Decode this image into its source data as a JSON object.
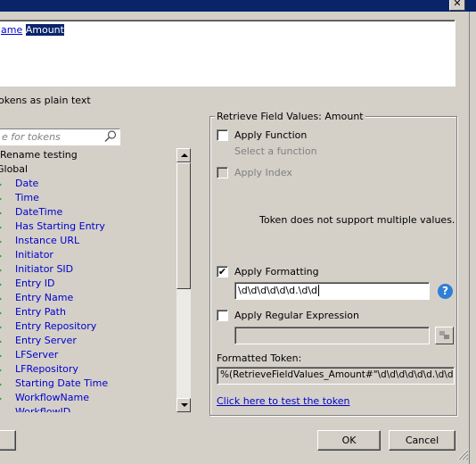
{
  "expression": {
    "prefix": "ame",
    "token": "Amount"
  },
  "plain_text_label": "okens as plain text",
  "search": {
    "placeholder": "e for tokens"
  },
  "tree": {
    "root": "Rename testing",
    "group": "Global",
    "items": [
      "Date",
      "Time",
      "DateTime",
      "Has Starting Entry",
      "Instance URL",
      "Initiator",
      "Initiator SID",
      "Entry ID",
      "Entry Name",
      "Entry Path",
      "Entry Repository",
      "Entry Server",
      "LFServer",
      "LFRepository",
      "Starting Date Time",
      "WorkflowName",
      "WorkflowID"
    ]
  },
  "panel": {
    "title": "Retrieve Field Values: Amount",
    "apply_function": {
      "label": "Apply Function",
      "checked": false
    },
    "select_function": "Select a function",
    "apply_index": {
      "label": "Apply Index",
      "checked": false,
      "disabled": true
    },
    "multi_note": "Token does not support multiple values.",
    "apply_formatting": {
      "label": "Apply Formatting",
      "checked": true,
      "mark": "✔"
    },
    "formatting_value": "\\d\\d\\d\\d\\d\\d.\\d\\d",
    "apply_regex": {
      "label": "Apply Regular Expression",
      "checked": false
    },
    "regex_value": "",
    "formatted_label": "Formatted Token:",
    "formatted_value": "%(RetrieveFieldValues_Amount#\"\\d\\d\\d\\d\\d\\d.\\d\\d\"#)",
    "test_link": "Click here to test the token"
  },
  "buttons": {
    "ok": "OK",
    "cancel": "Cancel"
  },
  "colors": {
    "link": "#0000cc",
    "titlebar": "#0a246a",
    "arrow": "#1faa1f",
    "help": "#2f7fd6"
  },
  "icons": [
    "close-icon",
    "search-icon",
    "expand-arrow-icon",
    "help-icon",
    "regex-builder-icon",
    "size-grip-icon"
  ]
}
